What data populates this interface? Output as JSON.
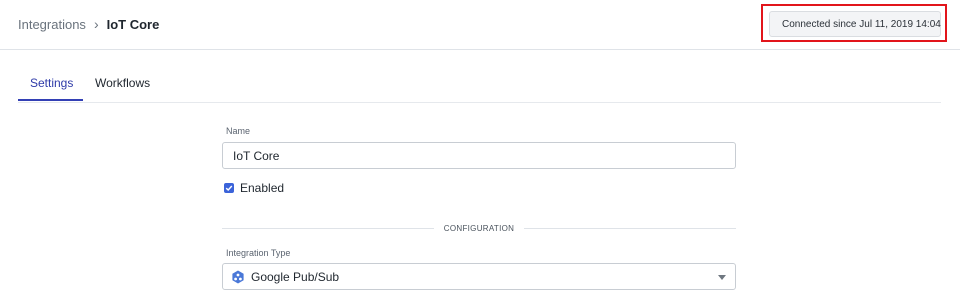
{
  "breadcrumb": {
    "parent": "Integrations",
    "separator": "›",
    "current": "IoT Core"
  },
  "status": {
    "text": "Connected since Jul 11, 2019 14:04",
    "icon": "plug-icon",
    "icon_color": "#8fb338"
  },
  "tabs": [
    {
      "label": "Settings",
      "active": true
    },
    {
      "label": "Workflows",
      "active": false
    }
  ],
  "form": {
    "name_label": "Name",
    "name_value": "IoT Core",
    "enabled_label": "Enabled",
    "enabled": true,
    "section_heading": "CONFIGURATION",
    "type_label": "Integration Type",
    "type_value": "Google Pub/Sub",
    "type_icon": "google-cloud-icon"
  },
  "colors": {
    "accent": "#3340b5",
    "highlight": "#e2151b",
    "checkbox": "#3b63d9"
  }
}
